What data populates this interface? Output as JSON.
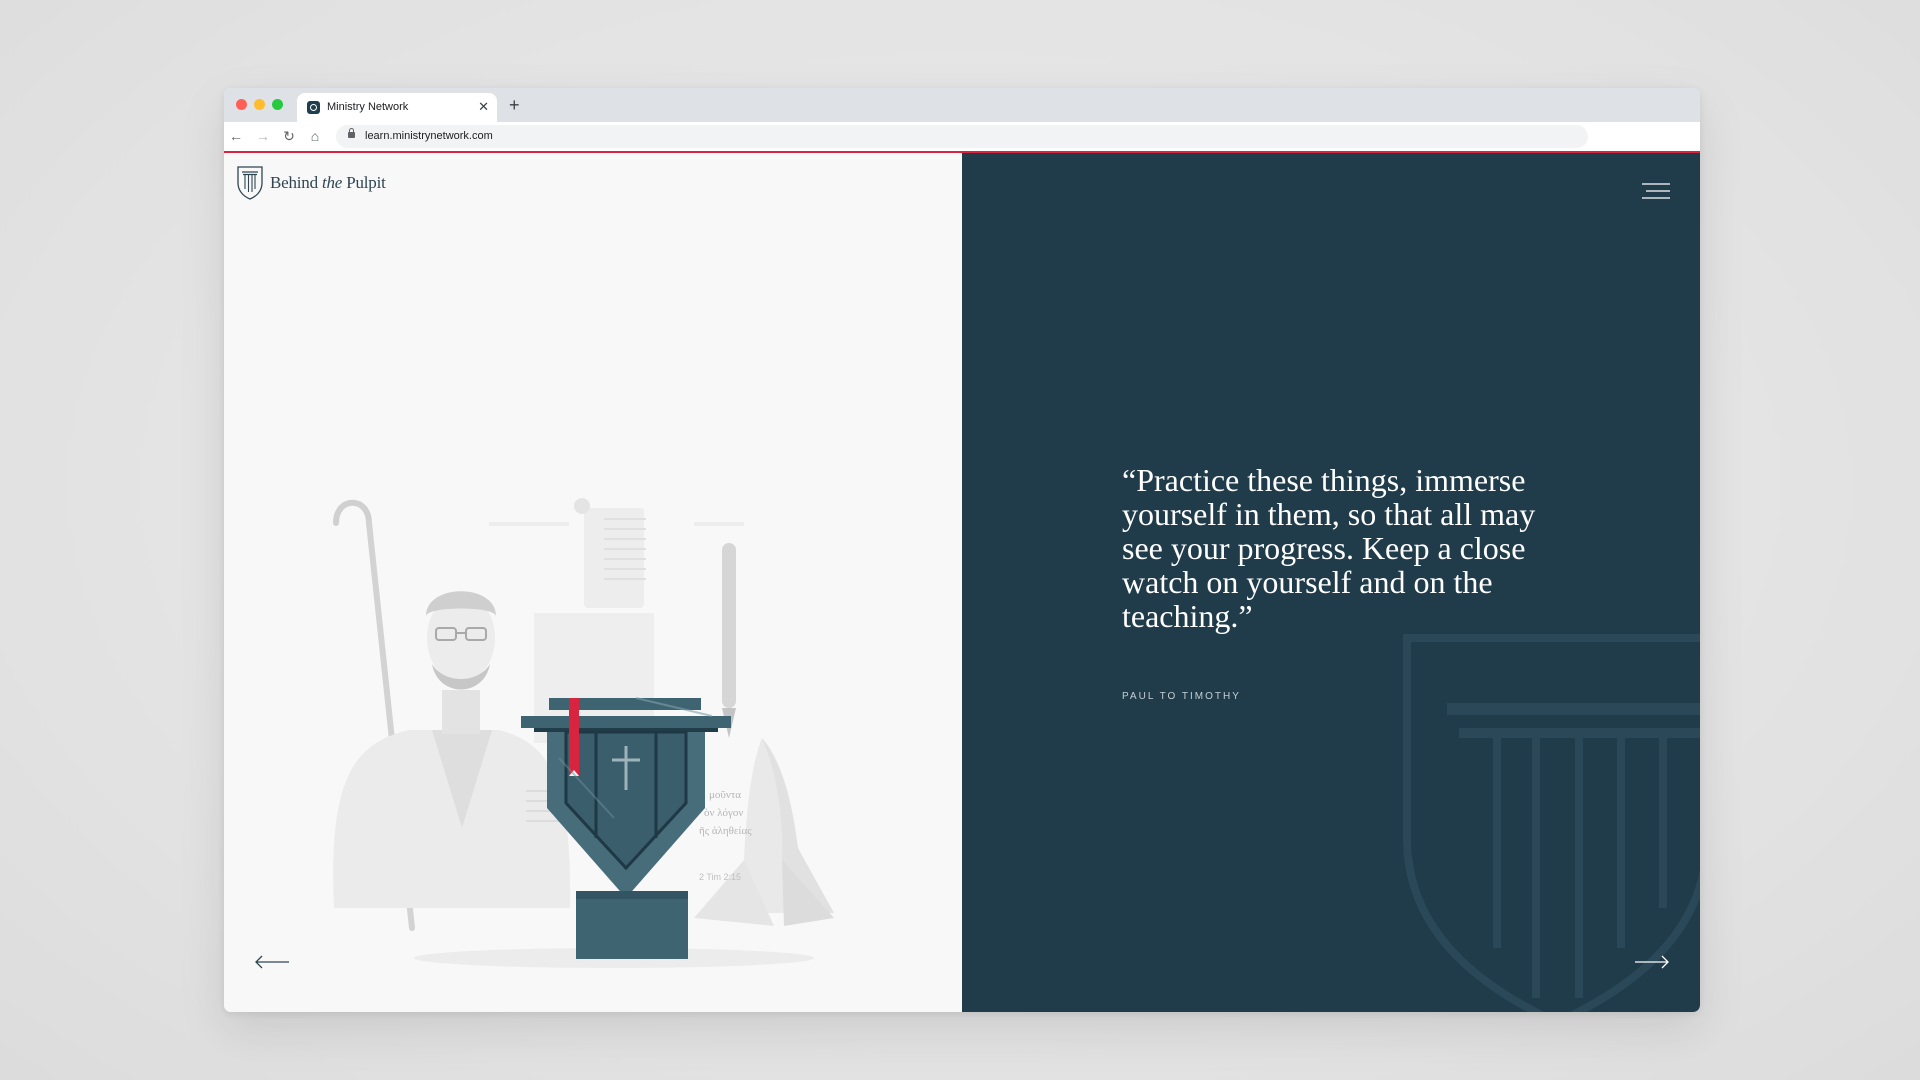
{
  "browser": {
    "tab_title": "Ministry Network",
    "tab_close_icon": "close-icon",
    "new_tab_label": "+",
    "url": "learn.ministrynetwork.com",
    "nav": {
      "back": "←",
      "forward": "→",
      "reload": "↻",
      "home": "⌂"
    },
    "accent": "#d9243f"
  },
  "site": {
    "logo_text_1": "Behind ",
    "logo_text_italic": "the",
    "logo_text_2": " Pulpit",
    "illustration": {
      "greek_lines": [
        "μοῦντα",
        "ὸν λόγον",
        "ῆς ἀληθείας"
      ],
      "verse_ref": "2 Tim 2:15"
    },
    "quote": "“Practice these things, immerse yourself in them, so that all may see your progress. Keep a close watch on yourself and on the teaching.”",
    "attribution": "PAUL TO TIMOTHY",
    "colors": {
      "left_bg": "#f8f8f8",
      "right_bg": "#203c4b",
      "pulpit": "#3f6471",
      "bookmark": "#d9243f"
    }
  }
}
